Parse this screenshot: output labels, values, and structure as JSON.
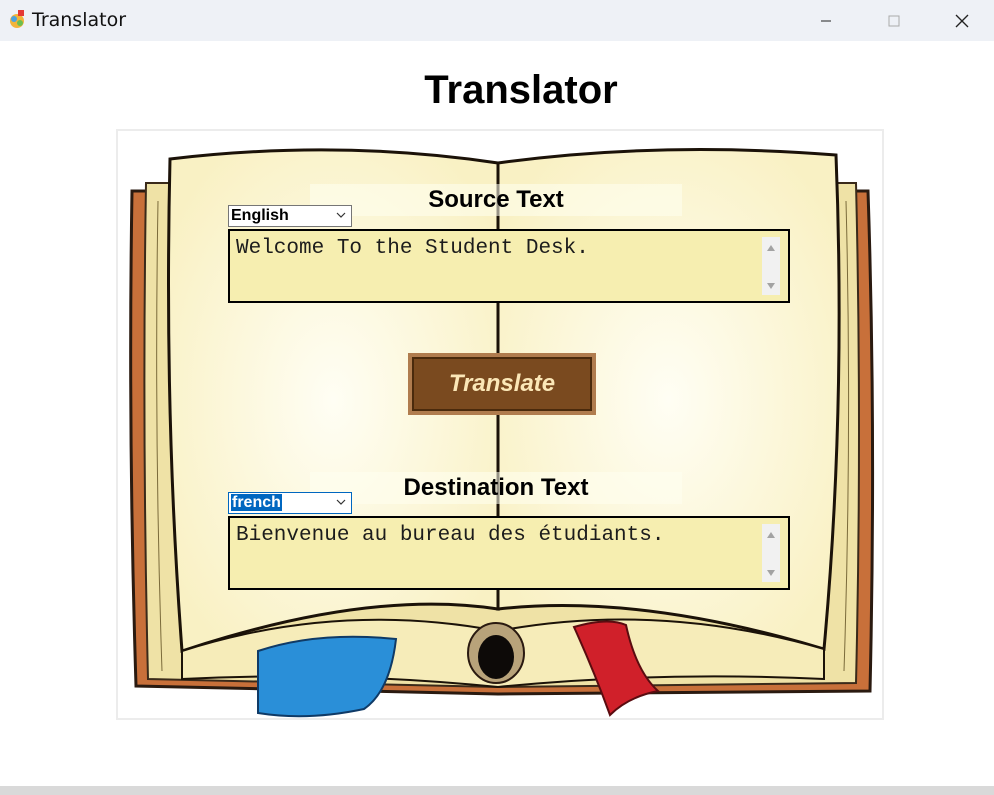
{
  "window": {
    "title": "Translator",
    "minimize_icon": "minimize-icon",
    "maximize_icon": "maximize-icon",
    "close_icon": "close-icon"
  },
  "page": {
    "heading": "Translator"
  },
  "source": {
    "heading": "Source Text",
    "language": "English",
    "text": "Welcome To the Student Desk."
  },
  "translate_button": {
    "label": "Translate"
  },
  "destination": {
    "heading": "Destination Text",
    "language": "french",
    "text": "Bienvenue au bureau des étudiants."
  },
  "colors": {
    "textbox_bg": "#f6eeb0",
    "button_bg": "#7a4a1f",
    "button_text": "#fbe7b7",
    "selection": "#0067c0"
  }
}
